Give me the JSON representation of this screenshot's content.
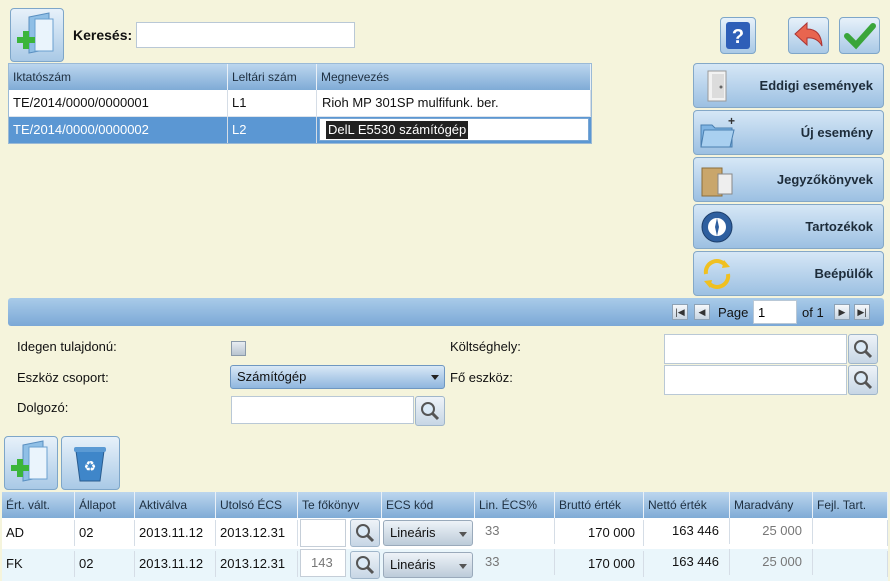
{
  "toolbar": {
    "search_label": "Keresés:",
    "search_value": "",
    "help_icon": "help-icon",
    "back_icon": "undo-icon",
    "ok_icon": "check-icon",
    "add_icon": "add-document-icon"
  },
  "top_grid": {
    "headers": [
      "Iktatószám",
      "Leltári szám",
      "Megnevezés"
    ],
    "rows": [
      [
        "TE/2014/0000/0000001",
        "L1",
        "Rioh MP 301SP mulfifunk. ber."
      ],
      [
        "TE/2014/0000/0000002",
        "L2",
        "DelL E5530 számítógép"
      ]
    ],
    "selected_row": 1
  },
  "side": {
    "events": "Eddigi események",
    "new_event": "Új esemény",
    "reports": "Jegyzőkönyvek",
    "accessories": "Tartozékok",
    "installed": "Beépülők"
  },
  "pager": {
    "page_label": "Page",
    "page": "1",
    "of_label": "of 1"
  },
  "form": {
    "foreign_label": "Idegen tulajdonú:",
    "group_label": "Eszköz csoport:",
    "group_value": "Számítógép",
    "employee_label": "Dolgozó:",
    "cost_center_label": "Költséghely:",
    "main_asset_label": "Fő eszköz:"
  },
  "bottom_grid": {
    "headers": [
      "Ért. vált.",
      "Állapot",
      "Aktiválva",
      "Utolsó ÉCS",
      "Te főkönyv",
      "ECS kód",
      "Lin. ÉCS%",
      "Bruttó érték",
      "Nettó érték",
      "Maradvány",
      "Fejl. Tart."
    ],
    "rows": [
      {
        "ert": "AD",
        "allapot": "02",
        "akt": "2013.11.12",
        "utolso": "2013.12.31",
        "fokonyv": "",
        "ecs": "Lineáris",
        "lin": "33",
        "brutto": "170 000",
        "netto": "163 446",
        "marad": "25 000",
        "fejl": ""
      },
      {
        "ert": "FK",
        "allapot": "02",
        "akt": "2013.11.12",
        "utolso": "2013.12.31",
        "fokonyv": "143",
        "ecs": "Lineáris",
        "lin": "33",
        "brutto": "170 000",
        "netto": "163 446",
        "marad": "25 000",
        "fejl": ""
      }
    ]
  }
}
